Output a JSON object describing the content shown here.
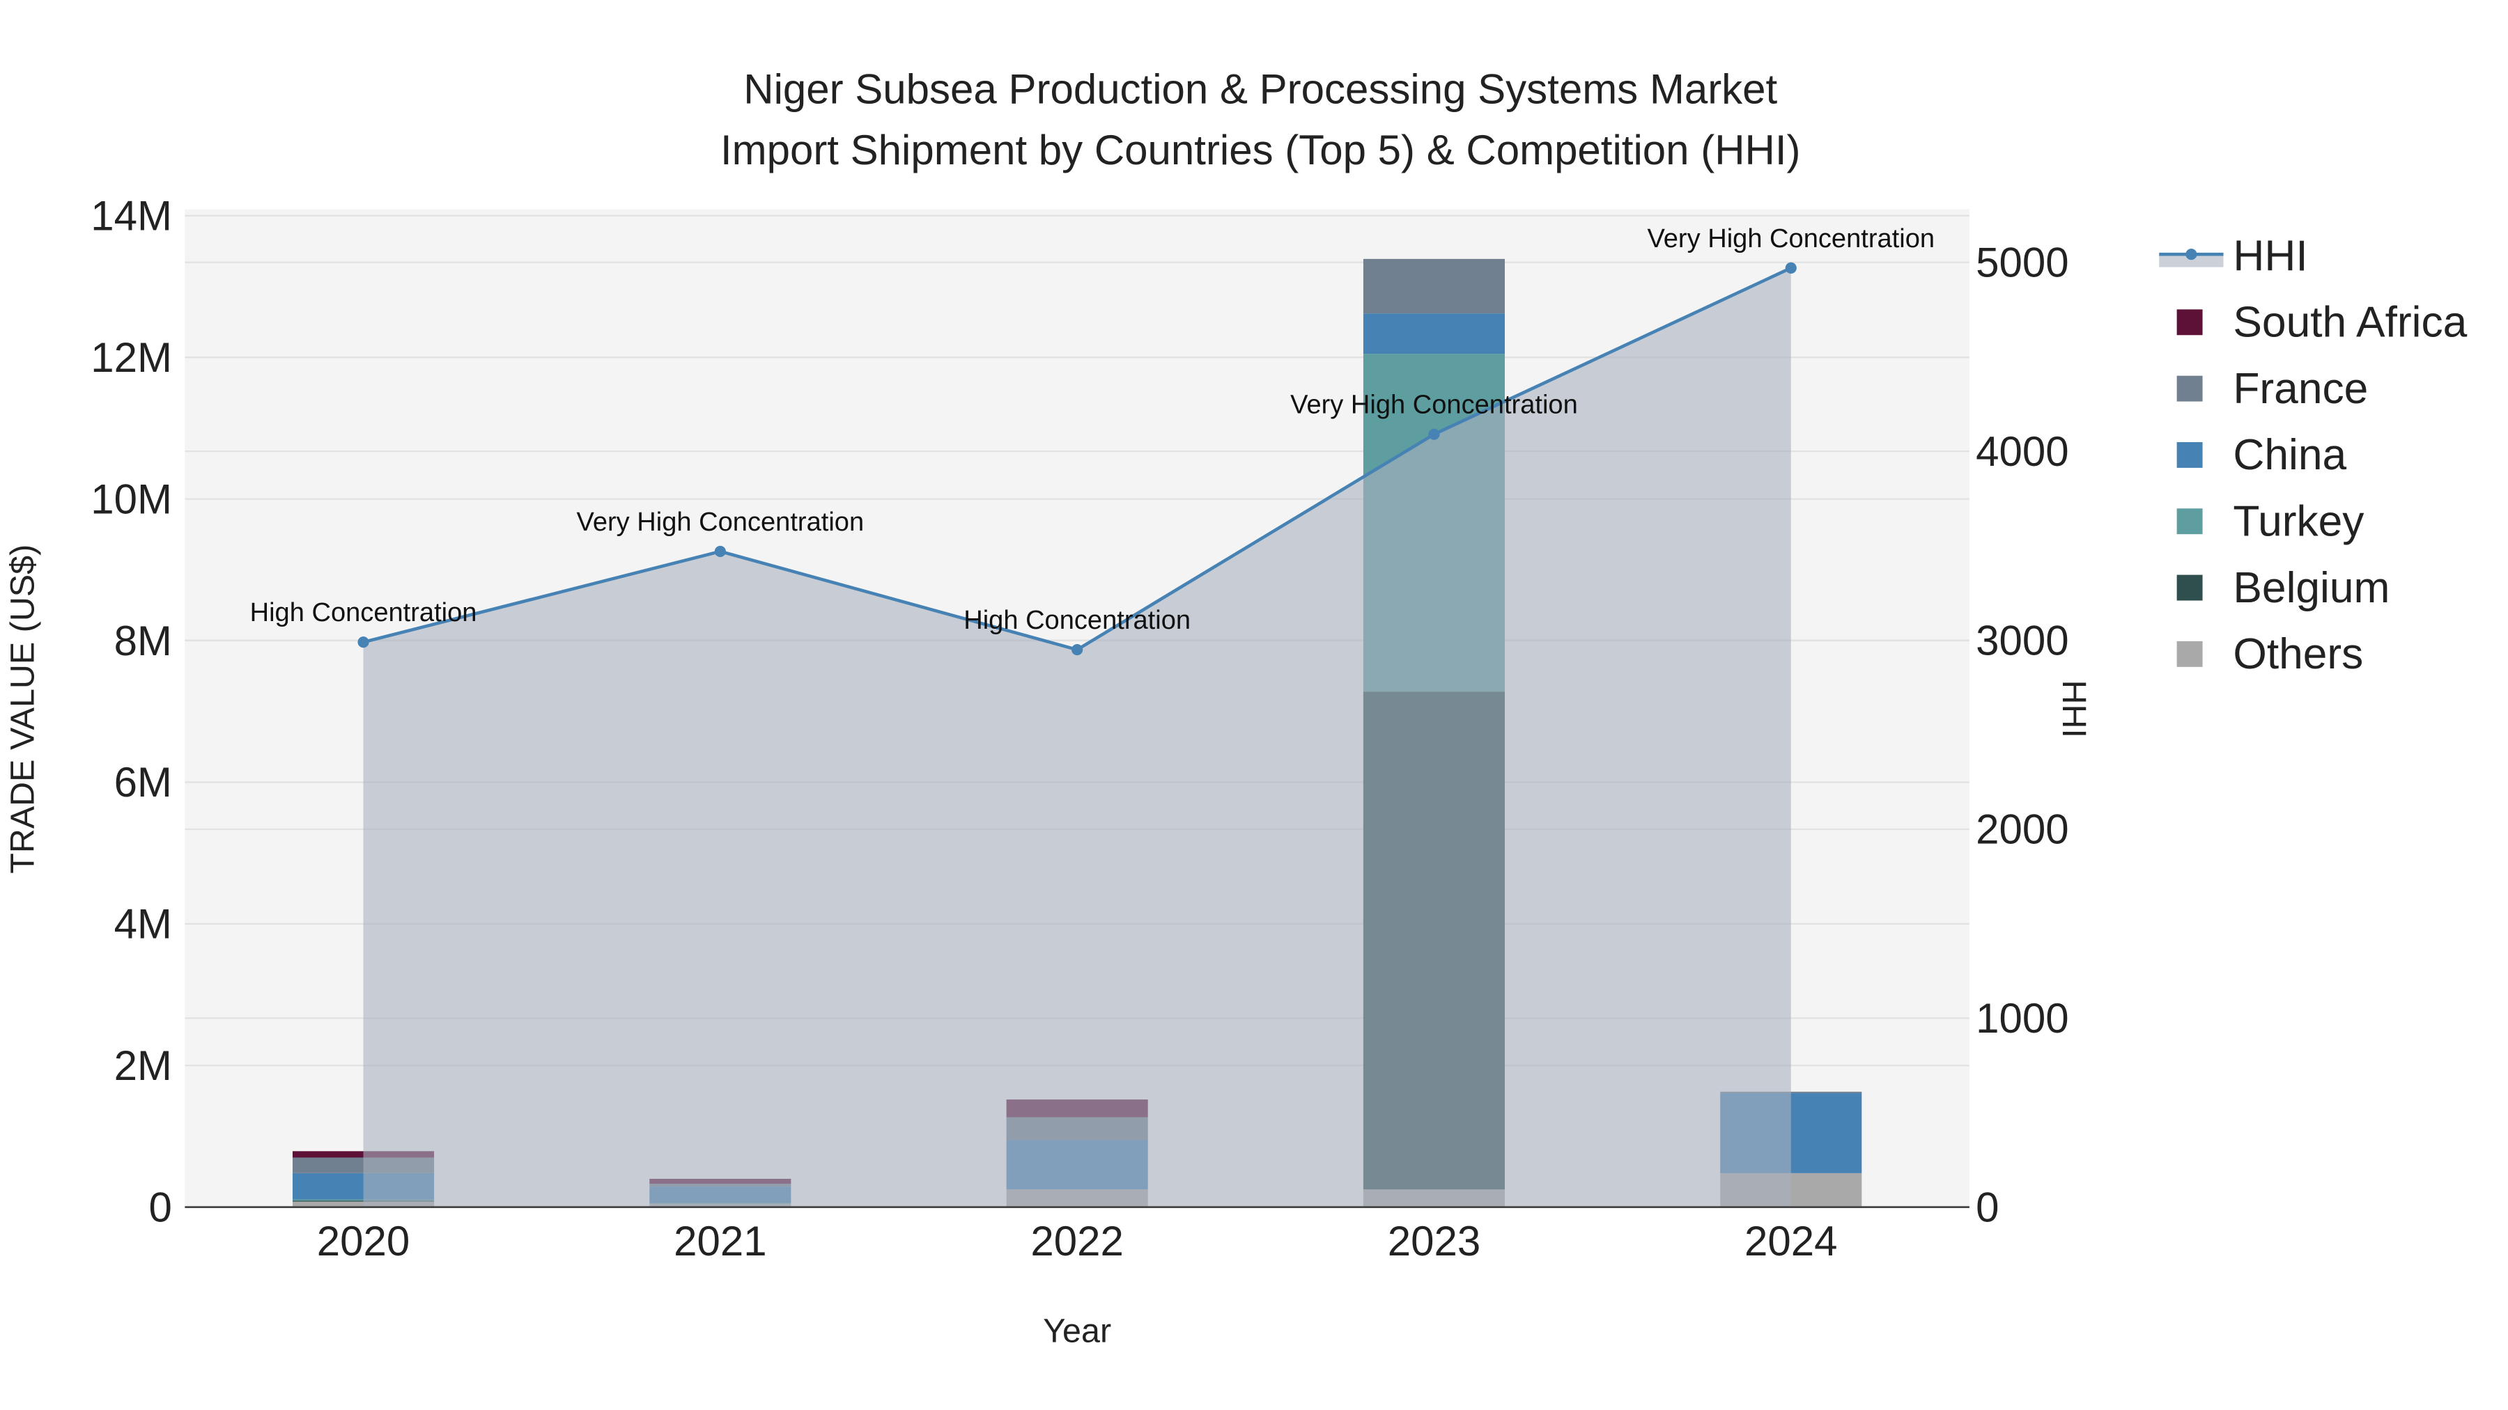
{
  "chart_data": {
    "type": "bar",
    "title_line1": "Niger Subsea Production & Processing Systems Market",
    "title_line2": "Import Shipment by Countries (Top 5) & Competition (HHI)",
    "xlabel": "Year",
    "ylabel": "TRADE VALUE (US$)",
    "y2label": "HHI",
    "categories": [
      "2020",
      "2021",
      "2022",
      "2023",
      "2024"
    ],
    "ylim": [
      0,
      14000000
    ],
    "y_ticks": [
      0,
      2000000,
      4000000,
      6000000,
      8000000,
      10000000,
      12000000,
      14000000
    ],
    "y_tick_labels": [
      "0",
      "2M",
      "4M",
      "6M",
      "8M",
      "10M",
      "12M",
      "14M"
    ],
    "y2lim": [
      0,
      5250
    ],
    "y2_ticks": [
      0,
      1000,
      2000,
      3000,
      4000,
      5000
    ],
    "y2_tick_labels": [
      "0",
      "1000",
      "2000",
      "3000",
      "4000",
      "5000"
    ],
    "series": [
      {
        "name": "Others",
        "color": "#a9a9a9",
        "values": [
          80000,
          50000,
          250000,
          250000,
          480000
        ]
      },
      {
        "name": "Belgium",
        "color": "#2f4f4f",
        "values": [
          10000,
          0,
          0,
          7030000,
          0
        ]
      },
      {
        "name": "Turkey",
        "color": "#5f9ea0",
        "values": [
          20000,
          10000,
          0,
          4770000,
          0
        ]
      },
      {
        "name": "China",
        "color": "#4682b4",
        "values": [
          370000,
          230000,
          700000,
          570000,
          1130000
        ]
      },
      {
        "name": "France",
        "color": "#708090",
        "values": [
          220000,
          40000,
          320000,
          770000,
          20000
        ]
      },
      {
        "name": "South Africa",
        "color": "#5e1136",
        "values": [
          90000,
          70000,
          250000,
          0,
          0
        ]
      }
    ],
    "legend_order": [
      "HHI",
      "South Africa",
      "France",
      "China",
      "Turkey",
      "Belgium",
      "Others"
    ],
    "hhi": {
      "name": "HHI",
      "color": "#4682b4",
      "values": [
        2990,
        3470,
        2950,
        4090,
        4970
      ],
      "labels": [
        "High Concentration",
        "Very High Concentration",
        "High Concentration",
        "Very High Concentration",
        "Very High Concentration"
      ]
    },
    "legend_position": "right",
    "grid": true
  }
}
